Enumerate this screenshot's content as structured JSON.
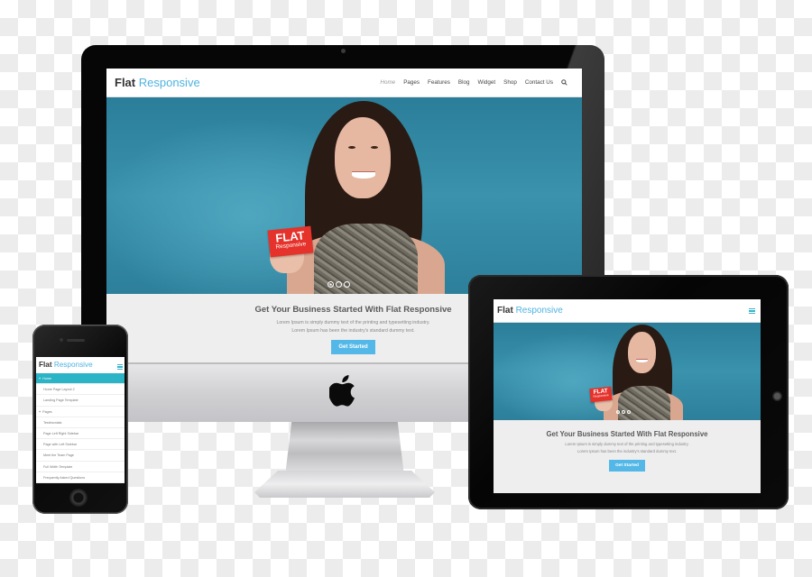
{
  "site": {
    "brand_primary": "Flat",
    "brand_accent": "Responsive",
    "accent_color": "#4fb3e0",
    "button_color": "#53b8e8",
    "mobile_menu_color": "#2bb3c6"
  },
  "desktop": {
    "nav": [
      "Home",
      "Pages",
      "Features",
      "Blog",
      "Widget",
      "Shop",
      "Contact Us"
    ],
    "active_nav": "Home",
    "search_icon": "search-icon",
    "hero": {
      "card_line1": "FLAT",
      "card_line2": "Responsive",
      "slides_total": 3,
      "slide_active": 1
    },
    "cta": {
      "title": "Get Your Business Started With Flat Responsive",
      "line1": "Lorem Ipsum is simply dummy text of the printing and typesetting industry.",
      "line2": "Lorem Ipsum has been the industry's standard dummy text.",
      "button": "Get Started"
    }
  },
  "tablet": {
    "menu_icon": "hamburger-icon",
    "hero": {
      "card_line1": "FLAT",
      "card_line2": "Responsive"
    },
    "cta": {
      "title": "Get Your Business Started With Flat Responsive",
      "line1": "Lorem Ipsum is simply dummy text of the printing and typesetting industry.",
      "line2": "Lorem Ipsum has been the industry's standard dummy text.",
      "button": "Get Started"
    }
  },
  "phone": {
    "menu_icon": "hamburger-icon",
    "menu": [
      {
        "label": "Home",
        "type": "parent",
        "active": true
      },
      {
        "label": "Home Page Layout 2",
        "type": "child"
      },
      {
        "label": "Landing Page Template",
        "type": "child"
      },
      {
        "label": "Pages",
        "type": "parent"
      },
      {
        "label": "Testimonials",
        "type": "child"
      },
      {
        "label": "Page Left Right Sidebar",
        "type": "child"
      },
      {
        "label": "Page with Left Sidebar",
        "type": "child"
      },
      {
        "label": "Meet the Team Page",
        "type": "child"
      },
      {
        "label": "Full Width Template",
        "type": "child"
      },
      {
        "label": "Frequently Asked Questions",
        "type": "child"
      }
    ]
  }
}
